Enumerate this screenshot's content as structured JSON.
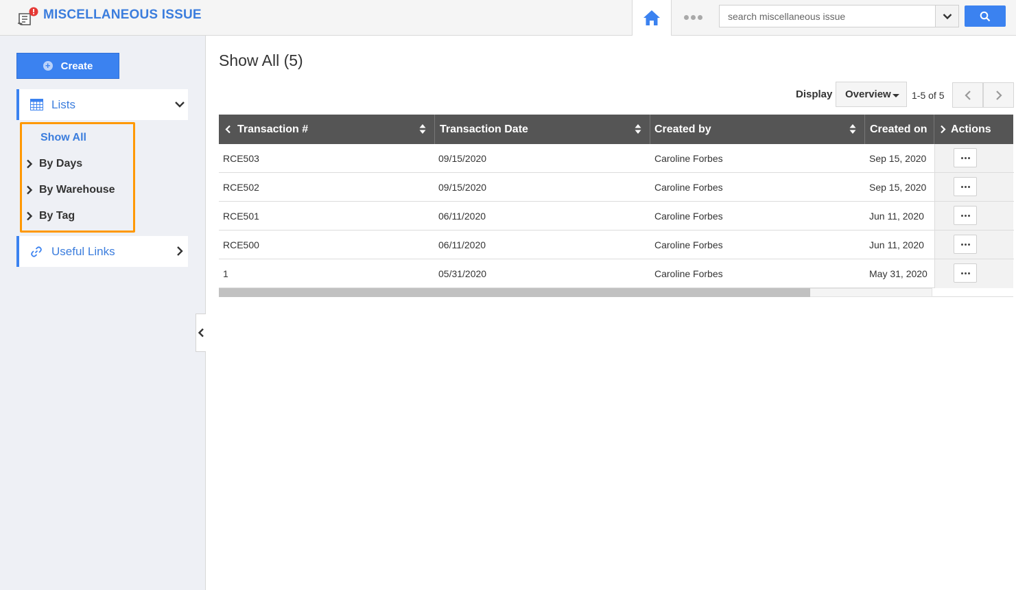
{
  "header": {
    "title": "MISCELLANEOUS ISSUE",
    "search_placeholder": "search miscellaneous issue",
    "accent_color": "#3b82f0",
    "icons": [
      "app-receipt-icon",
      "home-icon",
      "more-dots-icon",
      "chevron-down-icon",
      "search-icon"
    ]
  },
  "sidebar": {
    "create_label": "Create",
    "lists_label": "Lists",
    "useful_links_label": "Useful Links",
    "sub_items": [
      {
        "label": "Show All",
        "active": true
      },
      {
        "label": "By Days"
      },
      {
        "label": "By Warehouse"
      },
      {
        "label": "By Tag"
      }
    ],
    "highlight_color": "#ff9800"
  },
  "main": {
    "title": "Show All (5)",
    "display_label": "Display",
    "display_value": "Overview",
    "pager_text": "1-5 of 5",
    "columns": [
      "Transaction #",
      "Transaction Date",
      "Created by",
      "Created on",
      "Actions"
    ],
    "rows": [
      {
        "transaction": "RCE503",
        "date": "09/15/2020",
        "created_by": "Caroline Forbes",
        "created_on": "Sep 15, 2020"
      },
      {
        "transaction": "RCE502",
        "date": "09/15/2020",
        "created_by": "Caroline Forbes",
        "created_on": "Sep 15, 2020"
      },
      {
        "transaction": "RCE501",
        "date": "06/11/2020",
        "created_by": "Caroline Forbes",
        "created_on": "Jun 11, 2020"
      },
      {
        "transaction": "RCE500",
        "date": "06/11/2020",
        "created_by": "Caroline Forbes",
        "created_on": "Jun 11, 2020"
      },
      {
        "transaction": "1",
        "date": "05/31/2020",
        "created_by": "Caroline Forbes",
        "created_on": "May 31, 2020"
      }
    ]
  }
}
